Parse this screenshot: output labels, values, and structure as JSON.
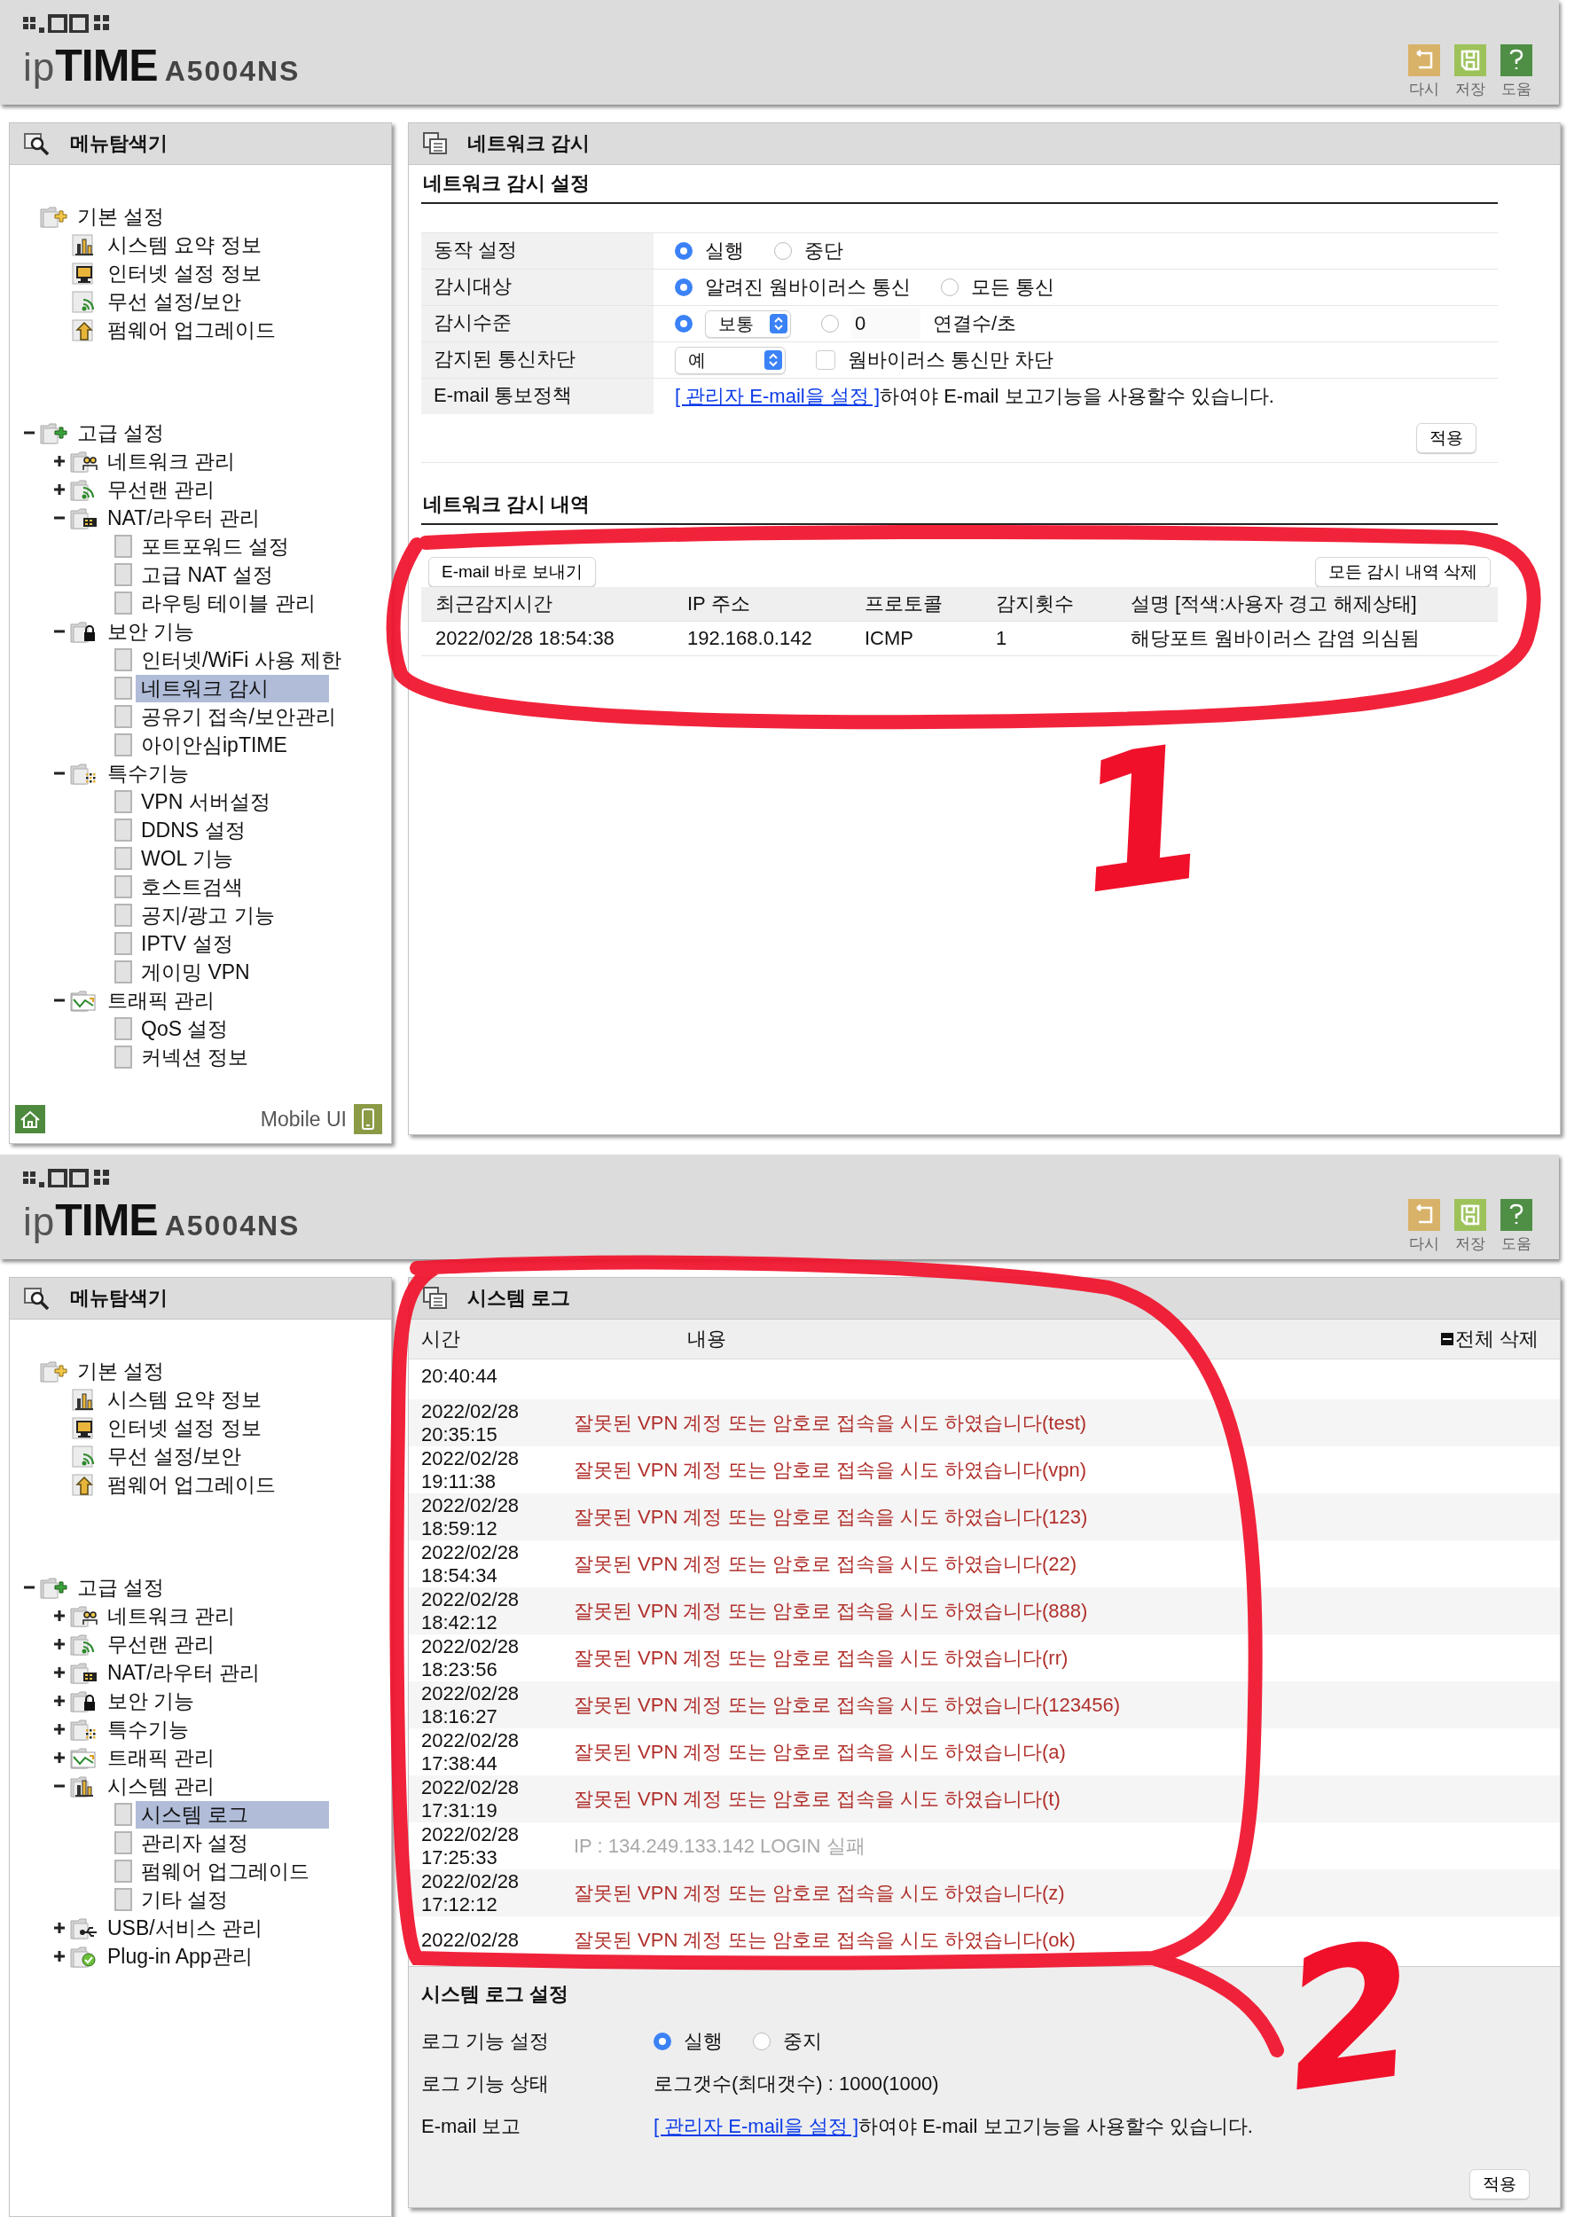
{
  "screens": [
    {
      "header": {
        "logo": {
          "prefix": "ip",
          "name": "TIME"
        },
        "model": "A5004NS",
        "actions": [
          {
            "kind": "undo",
            "label": "다시"
          },
          {
            "kind": "save",
            "label": "저장"
          },
          {
            "kind": "help",
            "label": "도움"
          }
        ]
      },
      "sidebar": {
        "title": "메뉴탐색기",
        "tree": [
          {
            "label": "기본 설정",
            "kind": "basic",
            "children": [
              {
                "label": "시스템 요약 정보",
                "kind": "chart",
                "selected": false
              },
              {
                "label": "인터넷 설정 정보",
                "kind": "monitor",
                "selected": false
              },
              {
                "label": "무선 설정/보안",
                "kind": "wireless",
                "selected": false
              },
              {
                "label": "펌웨어 업그레이드",
                "kind": "upload",
                "selected": false
              }
            ]
          },
          {
            "label": "고급 설정",
            "kind": "advanced",
            "expanded": true,
            "children": [
              {
                "label": "네트워크 관리",
                "kind": "network",
                "expanded": false
              },
              {
                "label": "무선랜 관리",
                "kind": "wireless",
                "expanded": false
              },
              {
                "label": "NAT/라우터 관리",
                "kind": "router",
                "expanded": true,
                "children": [
                  {
                    "label": "포트포워드 설정",
                    "selected": false
                  },
                  {
                    "label": "고급 NAT 설정",
                    "selected": false
                  },
                  {
                    "label": "라우팅 테이블 관리",
                    "selected": false
                  }
                ]
              },
              {
                "label": "보안 기능",
                "kind": "lock",
                "expanded": true,
                "children": [
                  {
                    "label": "인터넷/WiFi 사용 제한",
                    "selected": false
                  },
                  {
                    "label": "네트워크 감시",
                    "selected": true
                  },
                  {
                    "label": "공유기 접속/보안관리",
                    "selected": false
                  },
                  {
                    "label": "아이안심ipTIME",
                    "selected": false
                  }
                ]
              },
              {
                "label": "특수기능",
                "kind": "special",
                "expanded": true,
                "children": [
                  {
                    "label": "VPN 서버설정",
                    "selected": false
                  },
                  {
                    "label": "DDNS 설정",
                    "selected": false
                  },
                  {
                    "label": "WOL 기능",
                    "selected": false
                  },
                  {
                    "label": "호스트검색",
                    "selected": false
                  },
                  {
                    "label": "공지/광고 기능",
                    "selected": false
                  },
                  {
                    "label": "IPTV 설정",
                    "selected": false
                  },
                  {
                    "label": "게이밍 VPN",
                    "selected": false
                  }
                ]
              },
              {
                "label": "트래픽 관리",
                "kind": "traffic",
                "expanded": true,
                "children": [
                  {
                    "label": "QoS 설정",
                    "selected": false
                  },
                  {
                    "label": "커넥션 정보",
                    "selected": false
                  }
                ]
              }
            ]
          }
        ],
        "footer": {
          "label": "Mobile UI"
        }
      },
      "main": {
        "kind": "monitor",
        "title": "네트워크 감시",
        "settings": {
          "title": "네트워크 감시 설정",
          "rows": [
            {
              "kind": "radios",
              "label": "동작 설정",
              "options": [
                {
                  "label": "실행",
                  "selected": true
                },
                {
                  "label": "중단",
                  "selected": false
                }
              ]
            },
            {
              "kind": "radios",
              "label": "감시대상",
              "options": [
                {
                  "label": "알려진 웜바이러스 통신",
                  "selected": true
                },
                {
                  "label": "모든 통신",
                  "selected": false
                }
              ]
            },
            {
              "kind": "level",
              "label": "감시수준",
              "options": [
                {
                  "selected": true,
                  "select": "보통"
                },
                {
                  "selected": false,
                  "value": "0",
                  "unit": "연결수/초"
                }
              ]
            },
            {
              "kind": "block",
              "label": "감지된 통신차단",
              "select": "예",
              "checkbox": {
                "label": "웜바이러스 통신만 차단",
                "checked": false
              }
            },
            {
              "kind": "email",
              "label": "E-mail 통보정책",
              "link": "[ 관리자 E-mail을 설정 ]",
              "text": "하여야 E-mail 보고기능을 사용할수 있습니다."
            }
          ],
          "apply": "적용"
        },
        "history": {
          "title": "네트워크 감시 내역",
          "actions": [
            "E-mail 바로 보내기",
            "모든 감시 내역 삭제"
          ],
          "columns": [
            "최근감지시간",
            "IP 주소",
            "프로토콜",
            "감지횟수",
            "설명 [적색:사용자 경고 해제상태]"
          ],
          "rows": [
            [
              "2022/02/28 18:54:38",
              "192.168.0.142",
              "ICMP",
              "1",
              "해당포트 웜바이러스 감염 의심됨"
            ]
          ]
        }
      },
      "annotation": {
        "mark": "1"
      }
    },
    {
      "header": {
        "logo": {
          "prefix": "ip",
          "name": "TIME"
        },
        "model": "A5004NS",
        "actions": [
          {
            "kind": "undo",
            "label": "다시"
          },
          {
            "kind": "save",
            "label": "저장"
          },
          {
            "kind": "help",
            "label": "도움"
          }
        ]
      },
      "sidebar": {
        "title": "메뉴탐색기",
        "tree": [
          {
            "label": "기본 설정",
            "kind": "basic",
            "children": [
              {
                "label": "시스템 요약 정보",
                "kind": "chart",
                "selected": false
              },
              {
                "label": "인터넷 설정 정보",
                "kind": "monitor",
                "selected": false
              },
              {
                "label": "무선 설정/보안",
                "kind": "wireless",
                "selected": false
              },
              {
                "label": "펌웨어 업그레이드",
                "kind": "upload",
                "selected": false
              }
            ]
          },
          {
            "label": "고급 설정",
            "kind": "advanced",
            "expanded": true,
            "children": [
              {
                "label": "네트워크 관리",
                "kind": "network",
                "expanded": false
              },
              {
                "label": "무선랜 관리",
                "kind": "wireless",
                "expanded": false
              },
              {
                "label": "NAT/라우터 관리",
                "kind": "router",
                "expanded": false
              },
              {
                "label": "보안 기능",
                "kind": "lock",
                "expanded": false
              },
              {
                "label": "특수기능",
                "kind": "special",
                "expanded": false
              },
              {
                "label": "트래픽 관리",
                "kind": "traffic",
                "expanded": false
              },
              {
                "label": "시스템 관리",
                "kind": "system",
                "expanded": true,
                "children": [
                  {
                    "label": "시스템 로그",
                    "selected": true
                  },
                  {
                    "label": "관리자 설정",
                    "selected": false
                  },
                  {
                    "label": "펌웨어 업그레이드",
                    "selected": false
                  },
                  {
                    "label": "기타 설정",
                    "selected": false
                  }
                ]
              },
              {
                "label": "USB/서비스 관리",
                "kind": "usb",
                "expanded": false
              },
              {
                "label": "Plug-in App관리",
                "kind": "plugin",
                "expanded": false
              }
            ]
          }
        ]
      },
      "main": {
        "kind": "syslog",
        "title": "시스템 로그",
        "columns": [
          "시간",
          "내용"
        ],
        "clear": "전체 삭제",
        "rows": [
          {
            "time": "20:40:44"
          },
          {
            "date": "2022/02/28",
            "time": "20:35:15",
            "kind": "alert",
            "message": "잘못된 VPN 계정 또는 암호로 접속을 시도 하였습니다(test)"
          },
          {
            "date": "2022/02/28",
            "time": "19:11:38",
            "kind": "alert",
            "message": "잘못된 VPN 계정 또는 암호로 접속을 시도 하였습니다(vpn)"
          },
          {
            "date": "2022/02/28",
            "time": "18:59:12",
            "kind": "alert",
            "message": "잘못된 VPN 계정 또는 암호로 접속을 시도 하였습니다(123)"
          },
          {
            "date": "2022/02/28",
            "time": "18:54:34",
            "kind": "alert",
            "message": "잘못된 VPN 계정 또는 암호로 접속을 시도 하였습니다(22)"
          },
          {
            "date": "2022/02/28",
            "time": "18:42:12",
            "kind": "alert",
            "message": "잘못된 VPN 계정 또는 암호로 접속을 시도 하였습니다(888)"
          },
          {
            "date": "2022/02/28",
            "time": "18:23:56",
            "kind": "alert",
            "message": "잘못된 VPN 계정 또는 암호로 접속을 시도 하였습니다(rr)"
          },
          {
            "date": "2022/02/28",
            "time": "18:16:27",
            "kind": "alert",
            "message": "잘못된 VPN 계정 또는 암호로 접속을 시도 하였습니다(123456)"
          },
          {
            "date": "2022/02/28",
            "time": "17:38:44",
            "kind": "alert",
            "message": "잘못된 VPN 계정 또는 암호로 접속을 시도 하였습니다(a)"
          },
          {
            "date": "2022/02/28",
            "time": "17:31:19",
            "kind": "alert",
            "message": "잘못된 VPN 계정 또는 암호로 접속을 시도 하였습니다(t)"
          },
          {
            "date": "2022/02/28",
            "time": "17:25:33",
            "kind": "info",
            "message": "IP : 134.249.133.142 LOGIN 실패"
          },
          {
            "date": "2022/02/28",
            "time": "17:12:12",
            "kind": "alert",
            "message": "잘못된 VPN 계정 또는 암호로 접속을 시도 하였습니다(z)"
          },
          {
            "date": "2022/02/28",
            "kind": "alert",
            "message": "잘못된 VPN 계정 또는 암호로 접속을 시도 하였습니다(ok)"
          }
        ],
        "settings": {
          "title": "시스템 로그 설정",
          "rows": [
            {
              "kind": "radios",
              "label": "로그 기능 설정",
              "options": [
                {
                  "label": "실행",
                  "selected": true
                },
                {
                  "label": "중지",
                  "selected": false
                }
              ]
            },
            {
              "kind": "text",
              "label": "로그 기능 상태",
              "text": "로그갯수(최대갯수) : 1000(1000)"
            },
            {
              "kind": "email",
              "label": "E-mail 보고",
              "link": "[ 관리자 E-mail을 설정 ]",
              "text": "하여야 E-mail 보고기능을 사용할수 있습니다."
            }
          ],
          "apply": "적용"
        }
      },
      "annotation": {
        "mark": "2"
      }
    }
  ]
}
